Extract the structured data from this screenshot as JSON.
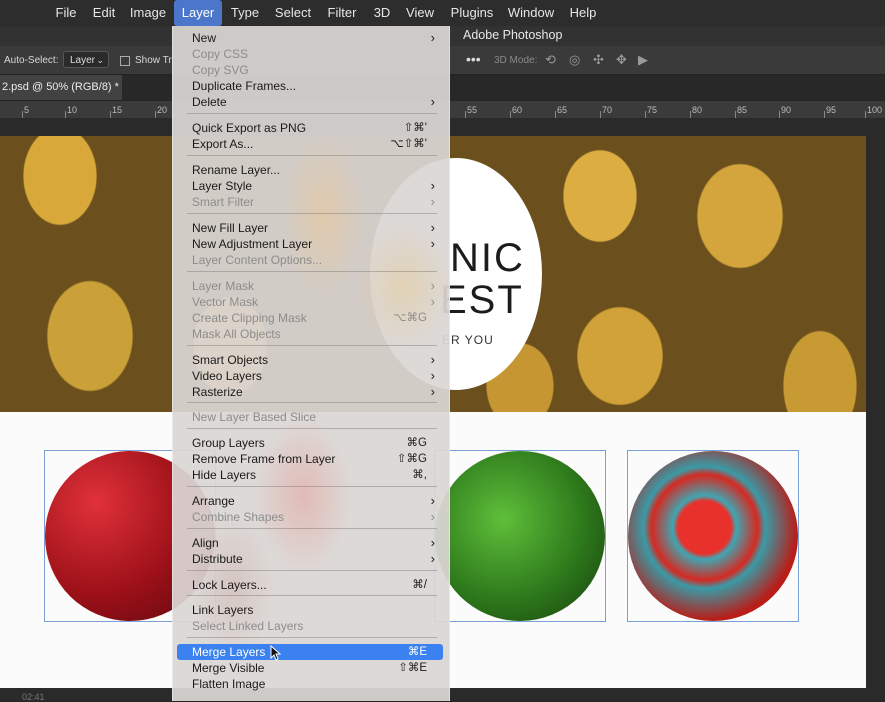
{
  "menubar": {
    "items": [
      "File",
      "Edit",
      "Image",
      "Layer",
      "Type",
      "Select",
      "Filter",
      "3D",
      "View",
      "Plugins",
      "Window",
      "Help"
    ],
    "active": "Layer"
  },
  "app_title": "Adobe Photoshop",
  "options": {
    "auto_select_label": "Auto-Select:",
    "auto_select_value": "Layer",
    "show_transform_label": "Show Tr",
    "three_d_mode_label": "3D Mode:",
    "more_icon": "ellipsis-icon"
  },
  "document_tab": {
    "title": "2.psd @ 50% (RGB/8) *"
  },
  "ruler": {
    "ticks": [
      "5",
      "10",
      "15",
      "20",
      "55",
      "60",
      "65",
      "70",
      "75",
      "80",
      "85",
      "90",
      "95",
      "100"
    ]
  },
  "artwork": {
    "badge_line1": "NIC",
    "badge_line2": "EST",
    "badge_line3": "ER YOU"
  },
  "status": {
    "time": "02:41"
  },
  "layer_menu": {
    "items": [
      {
        "label": "New",
        "shortcut": "",
        "submenu": true,
        "disabled": false
      },
      {
        "label": "Copy CSS",
        "shortcut": "",
        "submenu": false,
        "disabled": true
      },
      {
        "label": "Copy SVG",
        "shortcut": "",
        "submenu": false,
        "disabled": true
      },
      {
        "label": "Duplicate Frames...",
        "shortcut": "",
        "submenu": false,
        "disabled": false
      },
      {
        "label": "Delete",
        "shortcut": "",
        "submenu": true,
        "disabled": false
      },
      {
        "label": "Quick Export as PNG",
        "shortcut": "⇧⌘'",
        "submenu": false,
        "disabled": false
      },
      {
        "label": "Export As...",
        "shortcut": "⌥⇧⌘'",
        "submenu": false,
        "disabled": false
      },
      {
        "label": "Rename Layer...",
        "shortcut": "",
        "submenu": false,
        "disabled": false
      },
      {
        "label": "Layer Style",
        "shortcut": "",
        "submenu": true,
        "disabled": false
      },
      {
        "label": "Smart Filter",
        "shortcut": "",
        "submenu": true,
        "disabled": true
      },
      {
        "label": "New Fill Layer",
        "shortcut": "",
        "submenu": true,
        "disabled": false
      },
      {
        "label": "New Adjustment Layer",
        "shortcut": "",
        "submenu": true,
        "disabled": false
      },
      {
        "label": "Layer Content Options...",
        "shortcut": "",
        "submenu": false,
        "disabled": true
      },
      {
        "label": "Layer Mask",
        "shortcut": "",
        "submenu": true,
        "disabled": true
      },
      {
        "label": "Vector Mask",
        "shortcut": "",
        "submenu": true,
        "disabled": true
      },
      {
        "label": "Create Clipping Mask",
        "shortcut": "⌥⌘G",
        "submenu": false,
        "disabled": true
      },
      {
        "label": "Mask All Objects",
        "shortcut": "",
        "submenu": false,
        "disabled": true
      },
      {
        "label": "Smart Objects",
        "shortcut": "",
        "submenu": true,
        "disabled": false
      },
      {
        "label": "Video Layers",
        "shortcut": "",
        "submenu": true,
        "disabled": false
      },
      {
        "label": "Rasterize",
        "shortcut": "",
        "submenu": true,
        "disabled": false
      },
      {
        "label": "New Layer Based Slice",
        "shortcut": "",
        "submenu": false,
        "disabled": true
      },
      {
        "label": "Group Layers",
        "shortcut": "⌘G",
        "submenu": false,
        "disabled": false
      },
      {
        "label": "Remove Frame from Layer",
        "shortcut": "⇧⌘G",
        "submenu": false,
        "disabled": false
      },
      {
        "label": "Hide Layers",
        "shortcut": "⌘,",
        "submenu": false,
        "disabled": false
      },
      {
        "label": "Arrange",
        "shortcut": "",
        "submenu": true,
        "disabled": false
      },
      {
        "label": "Combine Shapes",
        "shortcut": "",
        "submenu": true,
        "disabled": true
      },
      {
        "label": "Align",
        "shortcut": "",
        "submenu": true,
        "disabled": false
      },
      {
        "label": "Distribute",
        "shortcut": "",
        "submenu": true,
        "disabled": false
      },
      {
        "label": "Lock Layers...",
        "shortcut": "⌘/",
        "submenu": false,
        "disabled": false
      },
      {
        "label": "Link Layers",
        "shortcut": "",
        "submenu": false,
        "disabled": false
      },
      {
        "label": "Select Linked Layers",
        "shortcut": "",
        "submenu": false,
        "disabled": true
      },
      {
        "label": "Merge Layers",
        "shortcut": "⌘E",
        "submenu": false,
        "disabled": false,
        "highlighted": true
      },
      {
        "label": "Merge Visible",
        "shortcut": "⇧⌘E",
        "submenu": false,
        "disabled": false
      },
      {
        "label": "Flatten Image",
        "shortcut": "",
        "submenu": false,
        "disabled": false
      }
    ]
  },
  "colors": {
    "menu_highlight": "#3b82f0",
    "menubar_active": "#4b76c9"
  }
}
